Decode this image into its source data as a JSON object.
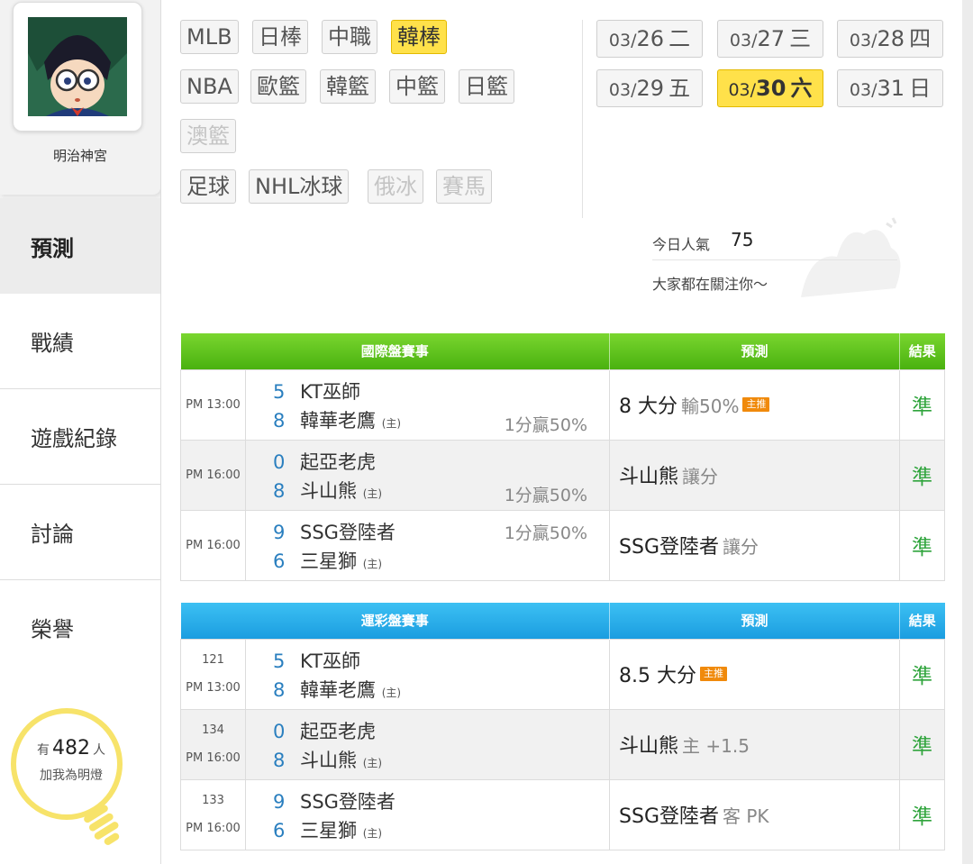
{
  "user": {
    "name": "明治神宮"
  },
  "nav": [
    {
      "label": "預測",
      "active": true
    },
    {
      "label": "戰績"
    },
    {
      "label": "遊戲紀錄"
    },
    {
      "label": "討論"
    },
    {
      "label": "榮譽"
    }
  ],
  "light": {
    "prefix": "有",
    "count": "482",
    "suffix": "人",
    "text": "加我為明燈"
  },
  "sports_rows": [
    [
      {
        "label": "MLB"
      },
      {
        "label": "日棒"
      },
      {
        "label": "中職"
      },
      {
        "label": "韓棒",
        "selected": true
      }
    ],
    [
      {
        "label": "NBA"
      },
      {
        "label": "歐籃"
      },
      {
        "label": "韓籃"
      },
      {
        "label": "中籃"
      },
      {
        "label": "日籃"
      }
    ],
    [
      {
        "label": "澳籃",
        "disabled": true
      }
    ],
    [
      {
        "label": "足球"
      },
      {
        "label": "NHL冰球"
      },
      {
        "label": "俄冰",
        "disabled": true
      },
      {
        "label": "賽馬",
        "disabled": true
      }
    ]
  ],
  "dates": [
    {
      "month": "03/",
      "day": "26",
      "weekday": "二"
    },
    {
      "month": "03/",
      "day": "27",
      "weekday": "三"
    },
    {
      "month": "03/",
      "day": "28",
      "weekday": "四"
    },
    {
      "month": "03/",
      "day": "29",
      "weekday": "五"
    },
    {
      "month": "03/",
      "day": "30",
      "weekday": "六",
      "selected": true
    },
    {
      "month": "03/",
      "day": "31",
      "weekday": "日"
    }
  ],
  "popularity": {
    "label": "今日人氣",
    "value": "75",
    "message": "大家都在關注你～"
  },
  "tables": [
    {
      "theme": "green",
      "headers": [
        "國際盤賽事",
        "預測",
        "結果"
      ],
      "rows": [
        {
          "time": "PM 13:00",
          "away": {
            "score": "5",
            "name": "KT巫師"
          },
          "home": {
            "score": "8",
            "name": "韓華老鷹",
            "tag": "(主)"
          },
          "odds": "1分贏50%",
          "odds_row": "home",
          "pick": "8 大分",
          "pick_sub": "輸50%",
          "badge": "主推",
          "result": "準"
        },
        {
          "time": "PM 16:00",
          "away": {
            "score": "0",
            "name": "起亞老虎"
          },
          "home": {
            "score": "8",
            "name": "斗山熊",
            "tag": "(主)"
          },
          "odds": "1分贏50%",
          "odds_row": "home",
          "pick": "斗山熊",
          "pick_sub": "讓分",
          "result": "準"
        },
        {
          "time": "PM 16:00",
          "away": {
            "score": "9",
            "name": "SSG登陸者"
          },
          "home": {
            "score": "6",
            "name": "三星獅",
            "tag": "(主)"
          },
          "odds": "1分贏50%",
          "odds_row": "away",
          "pick": "SSG登陸者",
          "pick_sub": "讓分",
          "result": "準"
        }
      ]
    },
    {
      "theme": "blue",
      "headers": [
        "運彩盤賽事",
        "預測",
        "結果"
      ],
      "rows": [
        {
          "num": "121",
          "time": "PM 13:00",
          "away": {
            "score": "5",
            "name": "KT巫師"
          },
          "home": {
            "score": "8",
            "name": "韓華老鷹",
            "tag": "(主)"
          },
          "pick": "8.5 大分",
          "badge": "主推",
          "result": "準"
        },
        {
          "num": "134",
          "time": "PM 16:00",
          "away": {
            "score": "0",
            "name": "起亞老虎"
          },
          "home": {
            "score": "8",
            "name": "斗山熊",
            "tag": "(主)"
          },
          "pick": "斗山熊",
          "pick_sub": "主 +1.5",
          "result": "準"
        },
        {
          "num": "133",
          "time": "PM 16:00",
          "away": {
            "score": "9",
            "name": "SSG登陸者"
          },
          "home": {
            "score": "6",
            "name": "三星獅",
            "tag": "(主)"
          },
          "pick": "SSG登陸者",
          "pick_sub": "客 PK",
          "result": "準"
        }
      ]
    }
  ]
}
